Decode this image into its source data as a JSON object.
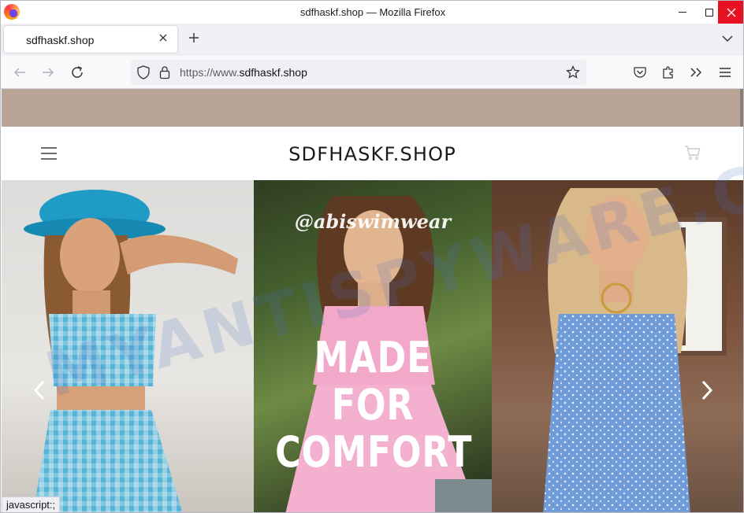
{
  "window": {
    "title": "sdfhaskf.shop — Mozilla Firefox",
    "controls": {
      "minimize": "minimize",
      "maximize": "maximize",
      "close": "close"
    }
  },
  "tabs": [
    {
      "title": "sdfhaskf.shop",
      "active": true
    }
  ],
  "navbar": {
    "url_prefix": "https://www.",
    "url_host": "sdfhaskf.shop"
  },
  "site": {
    "logo": "SDFHASKF.SHOP",
    "announcement_bar_color": "#b9a597",
    "hero": {
      "brand_tag": "@abiswimwear",
      "headline_line1": "MADE FOR",
      "headline_line2": "COMFORT",
      "panels": [
        {
          "description": "model in blue gingham top and skirt with blue bucket hat"
        },
        {
          "description": "model in pink dress in front of greenery"
        },
        {
          "description": "model in blue polka dot dress"
        }
      ]
    }
  },
  "watermark": "MYANTISPYWARE.COM",
  "status_bar": "javascript:;",
  "colors": {
    "accent_close": "#e81123",
    "tabstrip": "#f0f0f4",
    "toolbar": "#f9f9fb"
  }
}
